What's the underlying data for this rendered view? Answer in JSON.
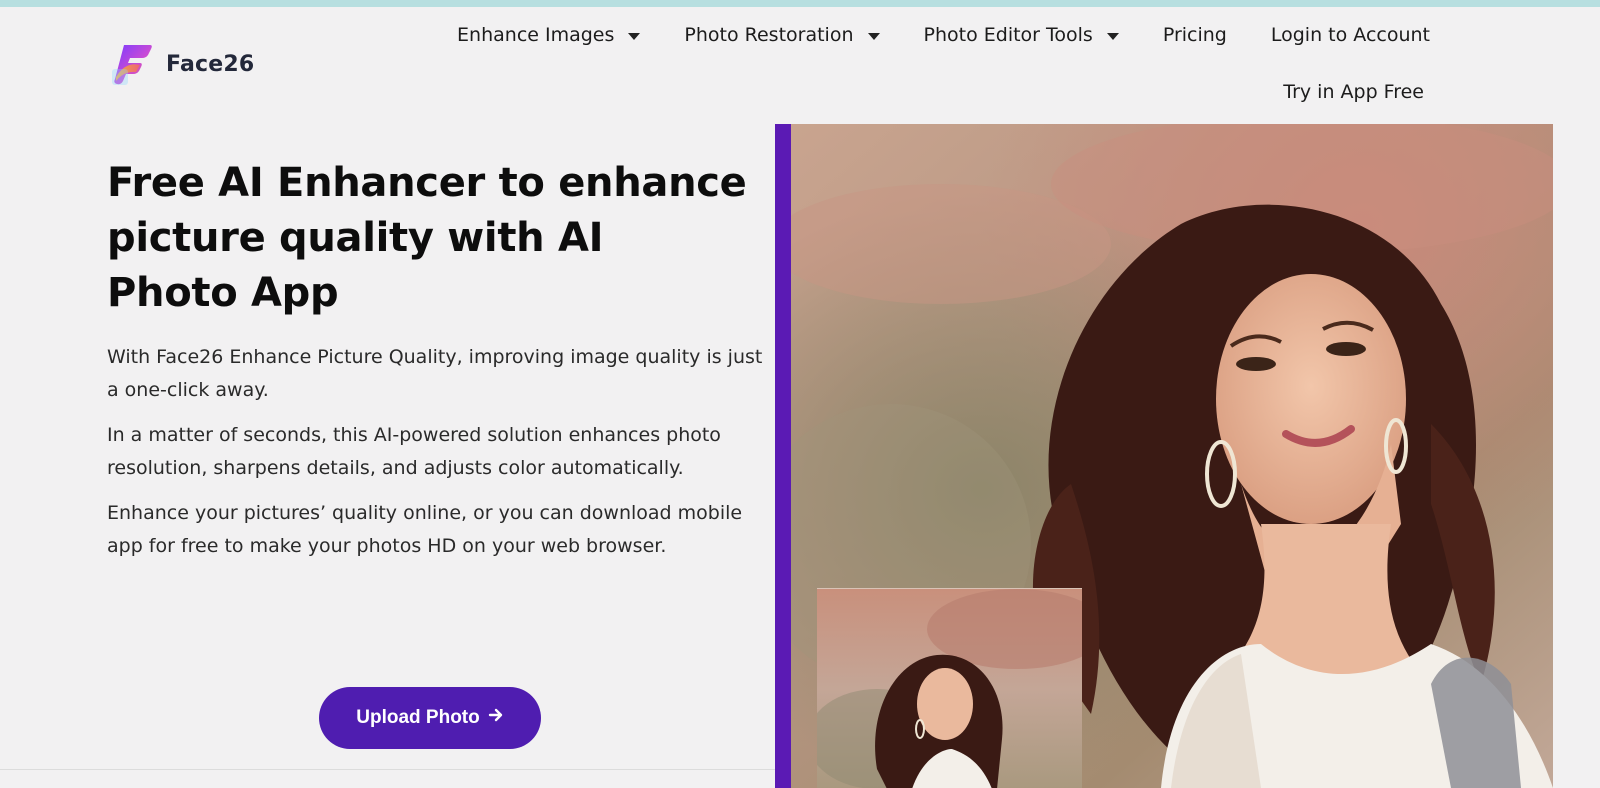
{
  "brand": {
    "name": "Face26",
    "colors": {
      "accent": "#4f1db0",
      "frame": "#5b1ab4",
      "logo_gradient": [
        "#6a3cff",
        "#e2496b",
        "#f7b733"
      ]
    }
  },
  "nav": {
    "items": [
      {
        "label": "Enhance Images",
        "has_dropdown": true
      },
      {
        "label": "Photo Restoration",
        "has_dropdown": true
      },
      {
        "label": "Photo Editor Tools",
        "has_dropdown": true
      },
      {
        "label": "Pricing",
        "has_dropdown": false
      },
      {
        "label": "Login to Account",
        "has_dropdown": false
      }
    ],
    "try_app": "Try in App Free"
  },
  "hero": {
    "title": "Free AI Enhancer to enhance picture quality with AI Photo App",
    "paragraphs": [
      "With Face26 Enhance Picture Quality, improving image quality is just a one-click away.",
      "In a matter of seconds, this AI-powered solution enhances photo resolution, sharpens details, and adjusts color automatically.",
      "Enhance your pictures’ quality online, or you can download mobile app for free to make your photos HD on your web browser."
    ],
    "upload_button": "Upload Photo",
    "upload_icon": "arrow-right-icon"
  }
}
